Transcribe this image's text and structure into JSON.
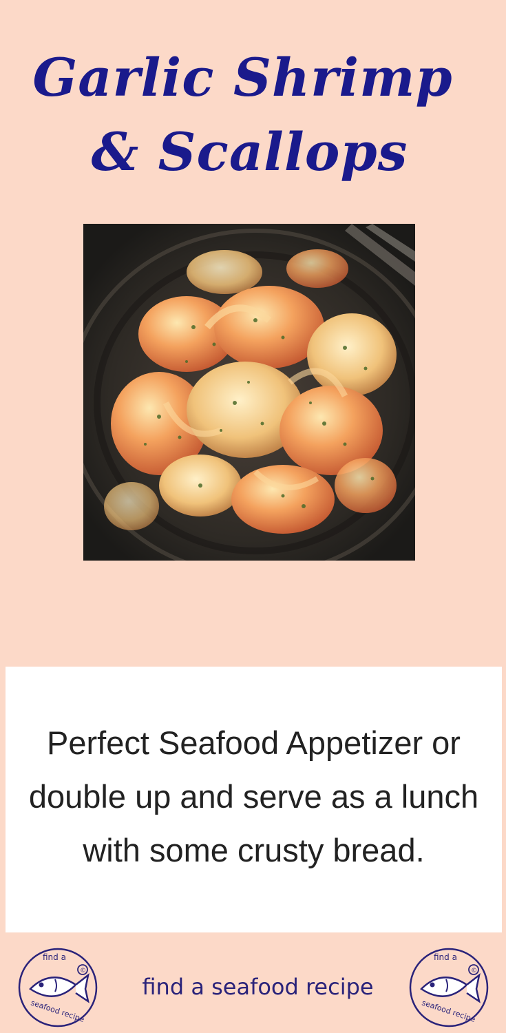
{
  "header": {
    "title_line1": "Garlic Shrimp",
    "title_line2": "& Scallops"
  },
  "photo": {
    "subject": "garlic shrimp and scallops on a plate"
  },
  "description": {
    "text": "Perfect Seafood Appetizer or double up and serve as a lunch with some crusty bread."
  },
  "footer": {
    "brand_text": "find a seafood recipe",
    "logo_top_text": "find a",
    "logo_bottom_text": "seafood recipe",
    "logo_mark": "©"
  },
  "colors": {
    "background": "#fcd9c8",
    "title": "#1a1a8c",
    "logo": "#2a237a"
  },
  "icons": [
    "fish-logo-icon"
  ]
}
